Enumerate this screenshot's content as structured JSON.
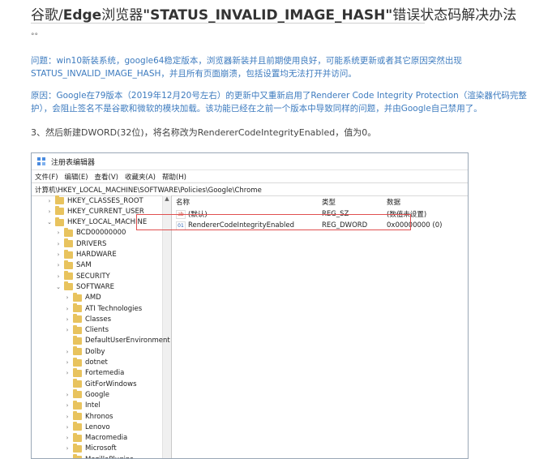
{
  "article": {
    "title_pre": "谷歌/",
    "title_bold1": "Edge",
    "title_mid": "浏览器",
    "title_bold2": "\"STATUS_INVALID_IMAGE_HASH\"",
    "title_post": "错误状态码解决办法",
    "dots": "°°",
    "p1": "问题：win10新装系统，google64稳定版本，浏览器新装并且前期使用良好，可能系统更新或者其它原因突然出现 STATUS_INVALID_IMAGE_HASH，并且所有页面崩溃，包括设置均无法打开并访问。",
    "p2": "原因：Google在79版本（2019年12月20号左右）的更新中又重新启用了Renderer Code Integrity Protection（渲染器代码完整护），会阻止签名不是谷歌和微软的模块加载。该功能已经在之前一个版本中导致同样的问题，并由Google自己禁用了。",
    "p3": "3、然后新建DWORD(32位)，将名称改为RendererCodeIntegrityEnabled，值为0。"
  },
  "regedit": {
    "window_title": "注册表编辑器",
    "menu": [
      "文件(F)",
      "编辑(E)",
      "查看(V)",
      "收藏夹(A)",
      "帮助(H)"
    ],
    "address": "计算机\\HKEY_LOCAL_MACHINE\\SOFTWARE\\Policies\\Google\\Chrome",
    "tree": [
      {
        "label": "HKEY_CLASSES_ROOT",
        "level": 0,
        "arrow": ">"
      },
      {
        "label": "HKEY_CURRENT_USER",
        "level": 0,
        "arrow": ">"
      },
      {
        "label": "HKEY_LOCAL_MACHINE",
        "level": 0,
        "arrow": "v"
      },
      {
        "label": "BCD00000000",
        "level": 1,
        "arrow": ">"
      },
      {
        "label": "DRIVERS",
        "level": 1,
        "arrow": ">"
      },
      {
        "label": "HARDWARE",
        "level": 1,
        "arrow": ">"
      },
      {
        "label": "SAM",
        "level": 1,
        "arrow": ">"
      },
      {
        "label": "SECURITY",
        "level": 1,
        "arrow": ">"
      },
      {
        "label": "SOFTWARE",
        "level": 1,
        "arrow": "v"
      },
      {
        "label": "AMD",
        "level": 2,
        "arrow": ">"
      },
      {
        "label": "ATI Technologies",
        "level": 2,
        "arrow": ">"
      },
      {
        "label": "Classes",
        "level": 2,
        "arrow": ">"
      },
      {
        "label": "Clients",
        "level": 2,
        "arrow": ">"
      },
      {
        "label": "DefaultUserEnvironment",
        "level": 2,
        "arrow": ""
      },
      {
        "label": "Dolby",
        "level": 2,
        "arrow": ">"
      },
      {
        "label": "dotnet",
        "level": 2,
        "arrow": ">"
      },
      {
        "label": "Fortemedia",
        "level": 2,
        "arrow": ">"
      },
      {
        "label": "GitForWindows",
        "level": 2,
        "arrow": ""
      },
      {
        "label": "Google",
        "level": 2,
        "arrow": ">"
      },
      {
        "label": "Intel",
        "level": 2,
        "arrow": ">"
      },
      {
        "label": "Khronos",
        "level": 2,
        "arrow": ">"
      },
      {
        "label": "Lenovo",
        "level": 2,
        "arrow": ">"
      },
      {
        "label": "Macromedia",
        "level": 2,
        "arrow": ">"
      },
      {
        "label": "Microsoft",
        "level": 2,
        "arrow": ">"
      },
      {
        "label": "MozillaPlugins",
        "level": 2,
        "arrow": ">"
      }
    ],
    "columns": {
      "name": "名称",
      "type": "类型",
      "data": "数据"
    },
    "values": [
      {
        "icon": "ab",
        "name": "(默认)",
        "type": "REG_SZ",
        "data": "(数值未设置)"
      },
      {
        "icon": "bin",
        "name": "RendererCodeIntegrityEnabled",
        "type": "REG_DWORD",
        "data": "0x00000000 (0)"
      }
    ]
  }
}
